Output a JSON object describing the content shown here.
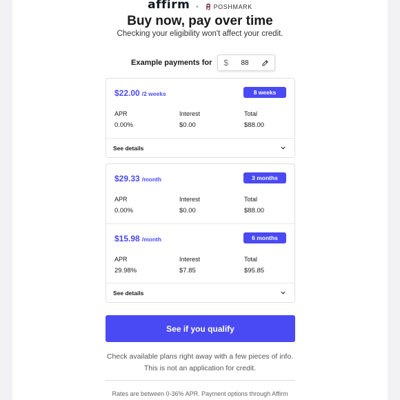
{
  "logos": {
    "affirm": "affirm",
    "plus": "+",
    "partner": "POSHMARK"
  },
  "headline": "Buy now, pay over time",
  "subhead": "Checking your eligibility won't affect your credit.",
  "example": {
    "label": "Example payments for",
    "currency": "$",
    "amount": "88"
  },
  "card1": {
    "plans": [
      {
        "price": "$22.00",
        "period": "/2 weeks",
        "badge": "8 weeks",
        "apr_label": "APR",
        "apr": "0.00%",
        "interest_label": "Interest",
        "interest": "$0.00",
        "total_label": "Total",
        "total": "$88.00"
      }
    ],
    "details_label": "See details"
  },
  "card2": {
    "plans": [
      {
        "price": "$29.33",
        "period": "/month",
        "badge": "3 months",
        "apr_label": "APR",
        "apr": "0.00%",
        "interest_label": "Interest",
        "interest": "$0.00",
        "total_label": "Total",
        "total": "$88.00"
      },
      {
        "price": "$15.98",
        "period": "/month",
        "badge": "6 months",
        "apr_label": "APR",
        "apr": "29.98%",
        "interest_label": "Interest",
        "interest": "$7.85",
        "total_label": "Total",
        "total": "$95.85"
      }
    ],
    "details_label": "See details"
  },
  "cta": {
    "label": "See if you qualify"
  },
  "note": {
    "line1": "Check available plans right away with a few pieces of info.",
    "line2": "This is not an application for credit."
  },
  "fineprint": "Rates are between 0-36% APR. Payment options through Affirm",
  "colors": {
    "accent": "#4a4af4",
    "text": "#1a1a1a",
    "muted": "#555555"
  },
  "icons": {
    "amount_edit": "pencil-icon",
    "expand": "chevron-down-icon",
    "partner": "poshmark-icon"
  }
}
